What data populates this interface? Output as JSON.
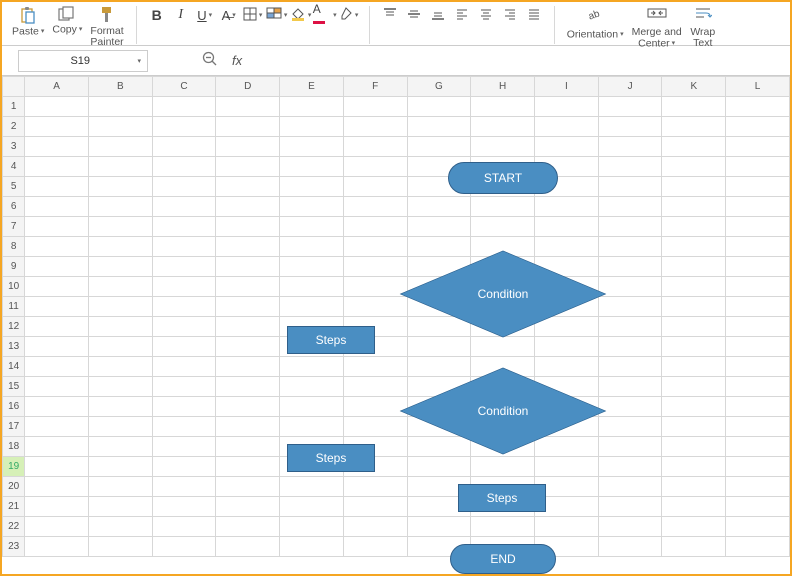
{
  "ribbon": {
    "paste": "Paste",
    "copy": "Copy",
    "format_painter_l1": "Format",
    "format_painter_l2": "Painter",
    "orientation": "Orientation",
    "merge_center_l1": "Merge and",
    "merge_center_l2": "Center",
    "wrap_l1": "Wrap",
    "wrap_l2": "Text"
  },
  "namebox": {
    "value": "S19"
  },
  "formula": {
    "fx": "fx",
    "value": ""
  },
  "columns": [
    "A",
    "B",
    "C",
    "D",
    "E",
    "F",
    "G",
    "H",
    "I",
    "J",
    "K",
    "L"
  ],
  "rows": [
    "1",
    "2",
    "3",
    "4",
    "5",
    "6",
    "7",
    "8",
    "9",
    "10",
    "11",
    "12",
    "13",
    "14",
    "15",
    "16",
    "17",
    "18",
    "19",
    "20",
    "21",
    "22",
    "23"
  ],
  "selected_row": "19",
  "shapes": {
    "start": "START",
    "condition1": "Condition",
    "steps1": "Steps",
    "condition2": "Condition",
    "steps2": "Steps",
    "steps3": "Steps",
    "end": "END"
  },
  "colors": {
    "shape_fill": "#4a8ec2",
    "shape_border": "#2f5f8a",
    "accent": "#f5a623"
  }
}
